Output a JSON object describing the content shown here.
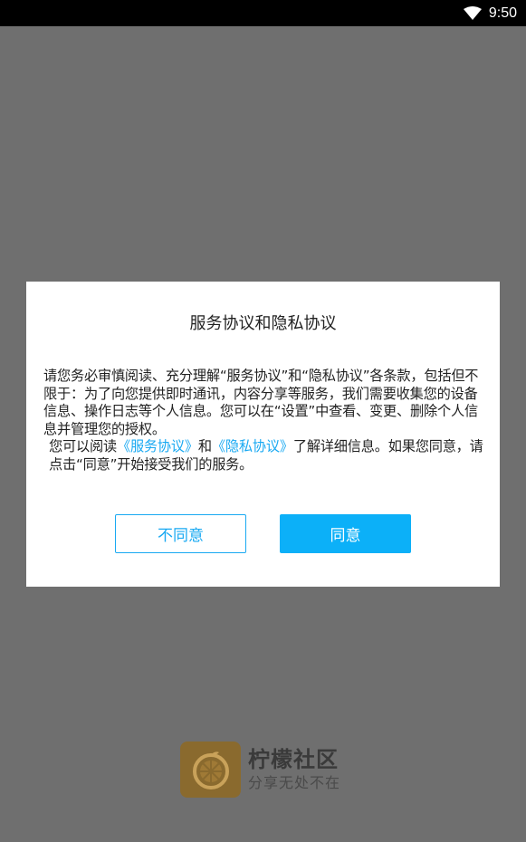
{
  "status_bar": {
    "time": "9:50",
    "wifi_icon": "wifi-icon"
  },
  "dialog": {
    "title": "服务协议和隐私协议",
    "paragraph1": "请您务必审慎阅读、充分理解“服务协议”和“隐私协议”各条款，包括但不限于：为了向您提供即时通讯，内容分享等服务，我们需要收集您的设备信息、操作日志等个人信息。您可以在“设置”中查看、变更、删除个人信息并管理您的授权。",
    "p2_prefix": "您可以阅读",
    "link_service": "《服务协议》",
    "p2_and": "和",
    "link_privacy": "《隐私协议》",
    "p2_suffix": "了解详细信息。如果您同意，请点击“同意”开始接受我们的服务。",
    "disagree_label": "不同意",
    "agree_label": "同意"
  },
  "brand": {
    "name": "柠檬社区",
    "slogan": "分享无处不在",
    "logo_icon": "lemon-slice-icon"
  },
  "colors": {
    "accent": "#0cb0f8",
    "link": "#19a9f2",
    "overlay": "#6f6f6f",
    "logo_bg": "#8a6a2e"
  }
}
